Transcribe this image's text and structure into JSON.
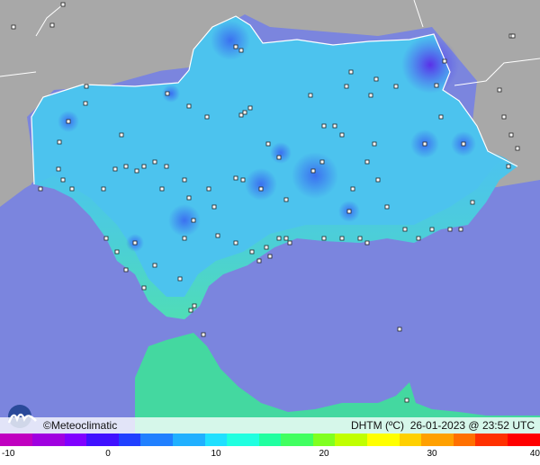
{
  "brand": {
    "name": "Meteoclimatic",
    "symbol": "©"
  },
  "header": {
    "variable": "DHTM (ºC)",
    "date": "26-01-2023",
    "at": "@",
    "time": "23:52",
    "tz": "UTC"
  },
  "legend": {
    "ticks": [
      "-10",
      "0",
      "10",
      "20",
      "30",
      "40"
    ],
    "min": -10,
    "max": 40,
    "colors": [
      "#c000c0",
      "#a000e0",
      "#8000ff",
      "#4010ff",
      "#2040ff",
      "#2080ff",
      "#20b0ff",
      "#20e0ff",
      "#20ffe0",
      "#20ffa0",
      "#40ff60",
      "#80ff20",
      "#c0ff00",
      "#ffff00",
      "#ffd000",
      "#ffa000",
      "#ff7000",
      "#ff3000",
      "#ff0000"
    ]
  },
  "colors": {
    "sea": "#7b85de",
    "land_out": "#a8a8a8",
    "andalucia": "#4cc3ee",
    "africa": "#44d8a0"
  }
}
